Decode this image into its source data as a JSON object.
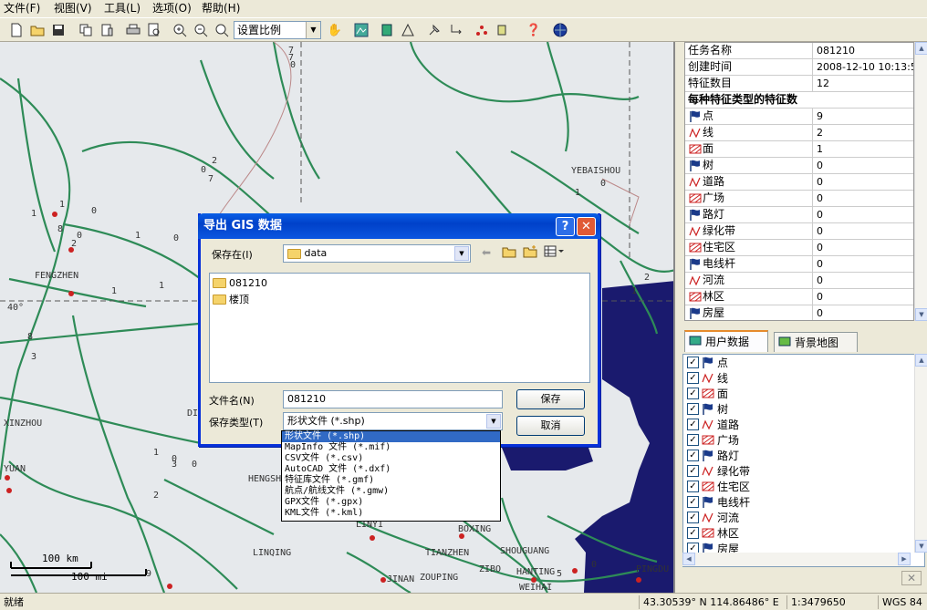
{
  "menu": [
    {
      "label": "文件(F)",
      "name": "menu-file"
    },
    {
      "label": "视图(V)",
      "name": "menu-view"
    },
    {
      "label": "工具(L)",
      "name": "menu-tools"
    },
    {
      "label": "选项(O)",
      "name": "menu-options"
    },
    {
      "label": "帮助(H)",
      "name": "menu-help"
    }
  ],
  "toolbar": {
    "scale_value": "设置比例",
    "icons": [
      "new-file-icon",
      "open-folder-icon",
      "save-icon",
      "copy-icon",
      "paste-icon",
      "print-icon",
      "print-preview-icon",
      "zoom-in-icon",
      "zoom-out-icon",
      "zoom-fit-icon",
      "pan-hand-icon",
      "map-icon",
      "layer-stack-icon",
      "measure-icon",
      "pushpin-icon",
      "route-icon",
      "points-icon",
      "tool-icon",
      "help-icon",
      "globe-icon"
    ]
  },
  "map": {
    "place_labels": [
      "YEBAISHOU",
      "FENGZHEN",
      "XINZHOU",
      "YUAN",
      "HENGSH",
      "DI",
      "LINYI",
      "BOXING",
      "LINQING",
      "TIANZHEN",
      "ZIBO",
      "SHOUGUANG",
      "HANTING",
      "PINGDU",
      "JINAN",
      "ZOUPING",
      "WEIHAI"
    ],
    "lat_label": "40°",
    "road_numbers": [
      "7",
      "0",
      "2",
      "0",
      "7",
      "1",
      "1",
      "8",
      "0",
      "1",
      "0",
      "0",
      "1",
      "1",
      "2",
      "1",
      "8",
      "3",
      "1",
      "0",
      "2",
      "0",
      "1",
      "5",
      "2",
      "0",
      "3",
      "0",
      "7",
      "9"
    ],
    "scalebar": {
      "km_label": "100  km",
      "mi_label": "100  mi"
    },
    "colors": {
      "land": "#e6e9ec",
      "sea": "#1a1a6e",
      "roads": "#2e8b57",
      "cities": "#cc2222"
    }
  },
  "properties": {
    "rows": [
      {
        "key": "任务名称",
        "value": "081210"
      },
      {
        "key": "创建时间",
        "value": "2008-12-10 10:13:5"
      },
      {
        "key": "特征数目",
        "value": "12"
      }
    ],
    "section_title": "每种特征类型的特征数",
    "features": [
      {
        "key": "点",
        "value": "9",
        "icon": "flag-icon"
      },
      {
        "key": "线",
        "value": "2",
        "icon": "line-icon"
      },
      {
        "key": "面",
        "value": "1",
        "icon": "area-icon"
      },
      {
        "key": "树",
        "value": "0",
        "icon": "flag-icon"
      },
      {
        "key": "道路",
        "value": "0",
        "icon": "line-icon"
      },
      {
        "key": "广场",
        "value": "0",
        "icon": "area-icon"
      },
      {
        "key": "路灯",
        "value": "0",
        "icon": "flag-icon"
      },
      {
        "key": "绿化带",
        "value": "0",
        "icon": "line-icon"
      },
      {
        "key": "住宅区",
        "value": "0",
        "icon": "area-icon"
      },
      {
        "key": "电线杆",
        "value": "0",
        "icon": "flag-icon"
      },
      {
        "key": "河流",
        "value": "0",
        "icon": "line-icon"
      },
      {
        "key": "林区",
        "value": "0",
        "icon": "area-icon"
      },
      {
        "key": "房屋",
        "value": "0",
        "icon": "flag-icon"
      }
    ]
  },
  "tabs": [
    {
      "label": "用户数据",
      "active": true,
      "icon": "user-data-icon"
    },
    {
      "label": "背景地图",
      "active": false,
      "icon": "background-map-icon"
    }
  ],
  "layers": [
    {
      "label": "点",
      "icon": "flag-icon"
    },
    {
      "label": "线",
      "icon": "line-icon"
    },
    {
      "label": "面",
      "icon": "area-icon"
    },
    {
      "label": "树",
      "icon": "flag-icon"
    },
    {
      "label": "道路",
      "icon": "line-icon"
    },
    {
      "label": "广场",
      "icon": "area-icon"
    },
    {
      "label": "路灯",
      "icon": "flag-icon"
    },
    {
      "label": "绿化带",
      "icon": "line-icon"
    },
    {
      "label": "住宅区",
      "icon": "area-icon"
    },
    {
      "label": "电线杆",
      "icon": "flag-icon"
    },
    {
      "label": "河流",
      "icon": "line-icon"
    },
    {
      "label": "林区",
      "icon": "area-icon"
    },
    {
      "label": "房屋",
      "icon": "flag-icon"
    }
  ],
  "dialog": {
    "title": "导出 GIS 数据",
    "help_btn": "?",
    "close_btn": "✕",
    "save_in_label": "保存在(I)",
    "folder": "data",
    "items": [
      "081210",
      "楼顶"
    ],
    "filename_label": "文件名(N)",
    "filename_value": "081210",
    "filetype_label": "保存类型(T)",
    "filetype_value": "形状文件 (*.shp)",
    "save_btn": "保存",
    "cancel_btn": "取消",
    "filetype_options": [
      "形状文件 (*.shp)",
      "MapInfo 文件 (*.mif)",
      "CSV文件 (*.csv)",
      "AutoCAD 文件 (*.dxf)",
      "特征库文件 (*.gmf)",
      "航点/航线文件 (*.gmw)",
      "GPX文件 (*.gpx)",
      "KML文件 (*.kml)"
    ]
  },
  "status": {
    "ready": "就绪",
    "coords": "43.30539° N 114.86486° E",
    "scale": "1:3479650",
    "datum": "WGS 84"
  }
}
